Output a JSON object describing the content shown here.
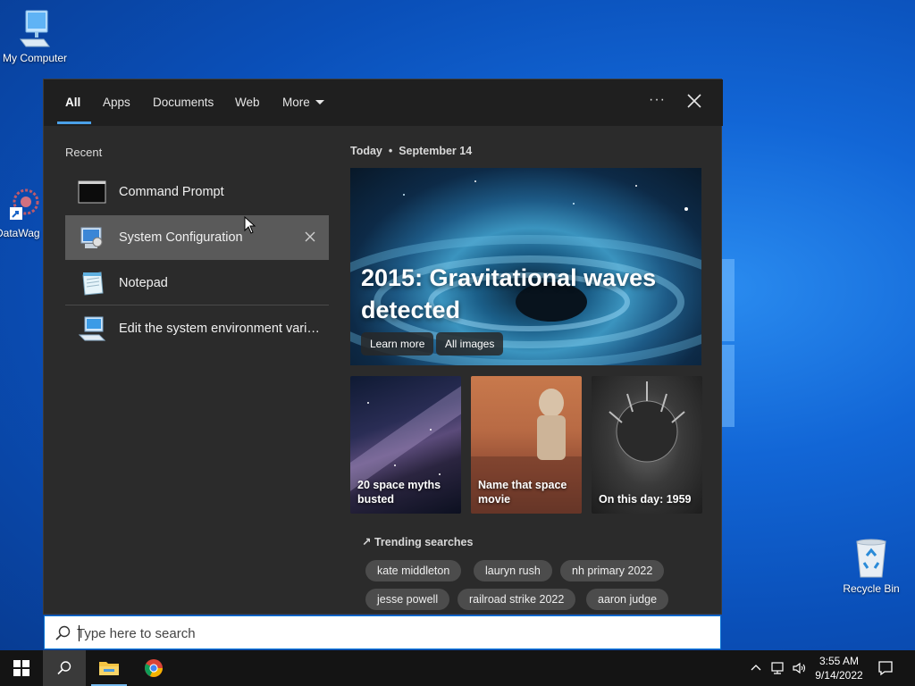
{
  "desktop": {
    "icons": [
      {
        "label": "My Computer",
        "icon": "computer-icon"
      },
      {
        "label": "DataWag",
        "icon": "shortcut-icon"
      },
      {
        "label": "Recycle Bin",
        "icon": "recycle-bin-icon"
      }
    ]
  },
  "search_panel": {
    "tabs": [
      {
        "label": "All",
        "active": true
      },
      {
        "label": "Apps"
      },
      {
        "label": "Documents"
      },
      {
        "label": "Web"
      },
      {
        "label": "More"
      }
    ],
    "more_options": "···",
    "recent_label": "Recent",
    "recent_items": [
      {
        "label": "Command Prompt",
        "icon": "command-prompt-icon"
      },
      {
        "label": "System Configuration",
        "icon": "system-config-icon"
      },
      {
        "label": "Notepad",
        "icon": "notepad-icon"
      },
      {
        "label": "Edit the system environment variables",
        "icon": "system-properties-icon"
      }
    ],
    "today": {
      "label": "Today",
      "separator": "•",
      "date": "September 14"
    },
    "hero": {
      "title": "2015: Gravitational waves detected",
      "learn_more": "Learn more",
      "all_images": "All images"
    },
    "cards": [
      {
        "caption": "20 space myths busted"
      },
      {
        "caption": "Name that space movie"
      },
      {
        "caption": "On this day: 1959"
      }
    ],
    "trending_label": "Trending searches",
    "trending": [
      "kate middleton",
      "lauryn rush",
      "nh primary 2022",
      "jesse powell",
      "railroad strike 2022",
      "aaron judge"
    ]
  },
  "search_box": {
    "placeholder": "Type here to search"
  },
  "taskbar": {
    "time": "3:55 AM",
    "date": "9/14/2022"
  },
  "colors": {
    "accent": "#0a78d7",
    "panel": "#2b2b2b",
    "topbar": "#1f1f1f",
    "hover": "#5a5a5a",
    "chip": "#4c4c4c"
  }
}
